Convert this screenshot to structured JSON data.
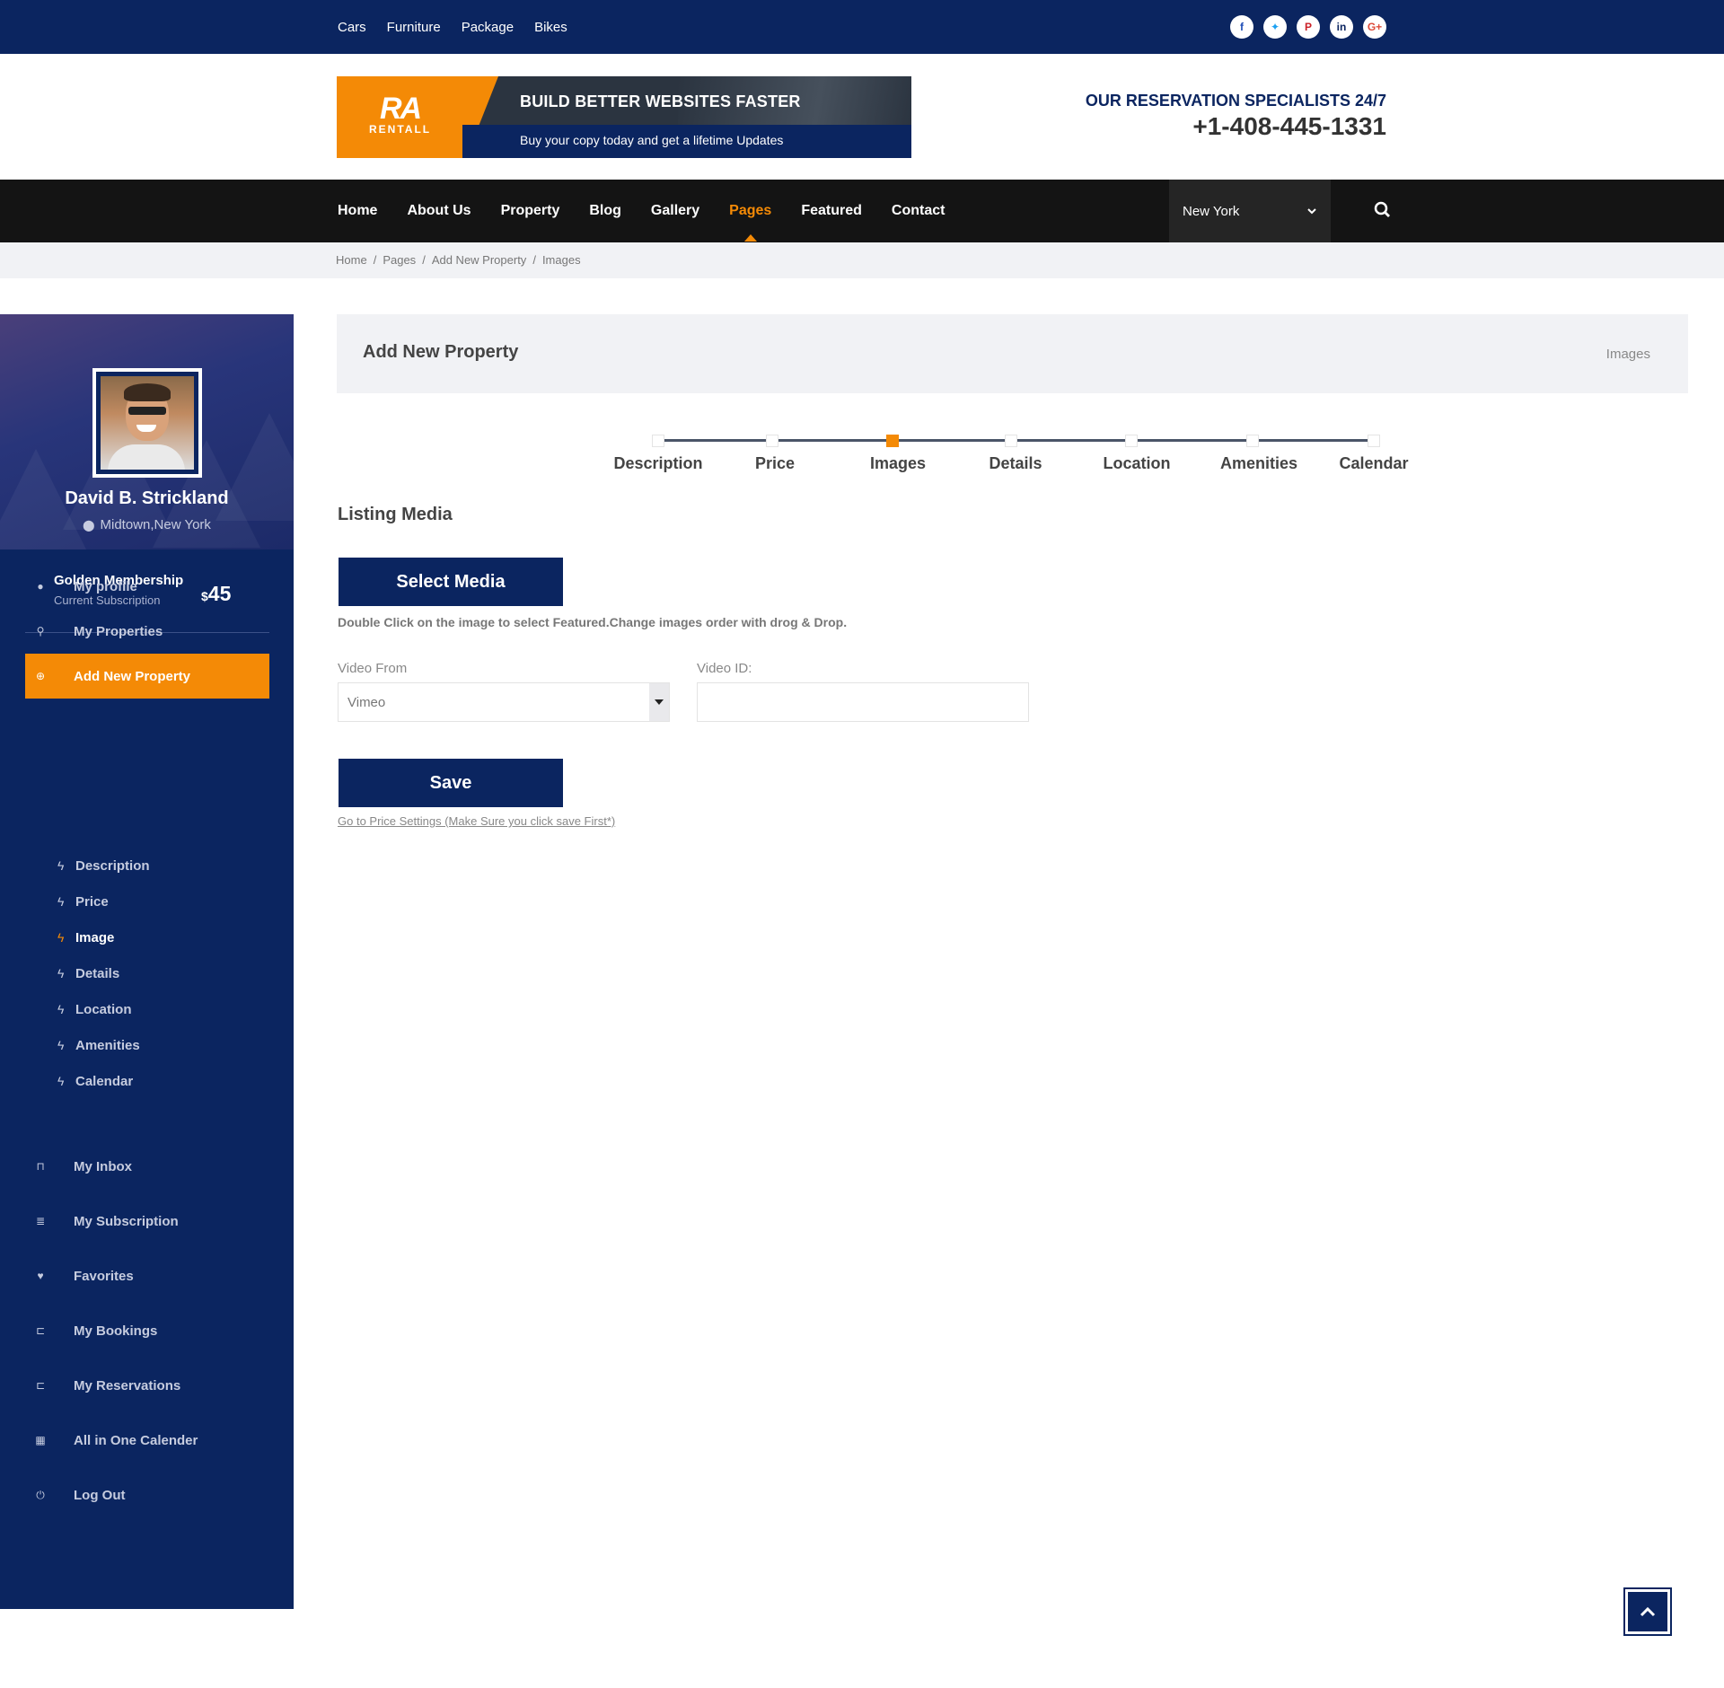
{
  "topbar": {
    "links": [
      "Cars",
      "Furniture",
      "Package",
      "Bikes"
    ],
    "social": [
      {
        "name": "facebook-icon",
        "glyph": "f",
        "color": "#1e4db7"
      },
      {
        "name": "twitter-icon",
        "glyph": "✦",
        "color": "#1da1f2"
      },
      {
        "name": "pinterest-icon",
        "glyph": "P",
        "color": "#cb2027"
      },
      {
        "name": "linkedin-icon",
        "glyph": "in",
        "color": "#0b2560"
      },
      {
        "name": "google-plus-icon",
        "glyph": "G+",
        "color": "#dd4b39"
      }
    ]
  },
  "header": {
    "logo_mark": "RA",
    "logo_name": "RENTALL",
    "banner_headline": "BUILD BETTER WEBSITES FASTER",
    "banner_sub": "Buy your copy today and get a lifetime Updates",
    "contact_label": "OUR RESERVATION SPECIALISTS 24/7",
    "phone": "+1-408-445-1331"
  },
  "nav": {
    "items": [
      "Home",
      "About Us",
      "Property",
      "Blog",
      "Gallery",
      "Pages",
      "Featured",
      "Contact"
    ],
    "active": "Pages",
    "city": "New York",
    "city_icon": "chevron-down-icon",
    "search_icon": "search-icon"
  },
  "breadcrumb": {
    "items": [
      "Home",
      "Pages",
      "Add New Property",
      "Images"
    ],
    "separator": "/"
  },
  "profile": {
    "name": "David B. Strickland",
    "location": "Midtown,New York",
    "membership": "Golden Membership",
    "subscription_label": "Current Subscription",
    "currency": "$",
    "price": "45"
  },
  "sidebar": {
    "menu": [
      {
        "label": "My profile",
        "icon": "user-icon",
        "glyph": "●"
      },
      {
        "label": "My Properties",
        "icon": "map-pin-icon",
        "glyph": "⚲"
      },
      {
        "label": "Add New Property",
        "icon": "plus-circle-icon",
        "glyph": "⊕",
        "active": true
      }
    ],
    "submenu": [
      {
        "label": "Description"
      },
      {
        "label": "Price"
      },
      {
        "label": "Image",
        "active": true
      },
      {
        "label": "Details"
      },
      {
        "label": "Location"
      },
      {
        "label": "Amenities"
      },
      {
        "label": "Calendar"
      }
    ],
    "menu_bottom": [
      {
        "label": "My Inbox",
        "icon": "inbox-icon",
        "glyph": "⊓"
      },
      {
        "label": "My Subscription",
        "icon": "list-icon",
        "glyph": "≣"
      },
      {
        "label": "Favorites",
        "icon": "heart-icon",
        "glyph": "♥"
      },
      {
        "label": "My Bookings",
        "icon": "folder-open-icon",
        "glyph": "⊏"
      },
      {
        "label": "My Reservations",
        "icon": "folder-icon",
        "glyph": "⊏"
      },
      {
        "label": "All in One Calender",
        "icon": "calendar-icon",
        "glyph": "▦"
      },
      {
        "label": "Log Out",
        "icon": "power-icon",
        "glyph": "⏻"
      }
    ]
  },
  "main": {
    "title": "Add New Property",
    "title_right": "Images",
    "steps": [
      "Description",
      "Price",
      "Images",
      "Details",
      "Location",
      "Amenities",
      "Calendar"
    ],
    "active_step": 2,
    "section_title": "Listing Media",
    "select_media": "Select Media",
    "hint": "Double Click on the image to select Featured.Change images order with drog & Drop.",
    "video_from_label": "Video From",
    "video_from_value": "Vimeo",
    "video_id_label": "Video ID:",
    "video_id_value": "",
    "save": "Save",
    "next_link": "Go to Price Settings (Make Sure you click save First*)"
  },
  "colors": {
    "navy": "#0b2560",
    "orange": "#f48a06",
    "nav_bg": "#141414"
  }
}
